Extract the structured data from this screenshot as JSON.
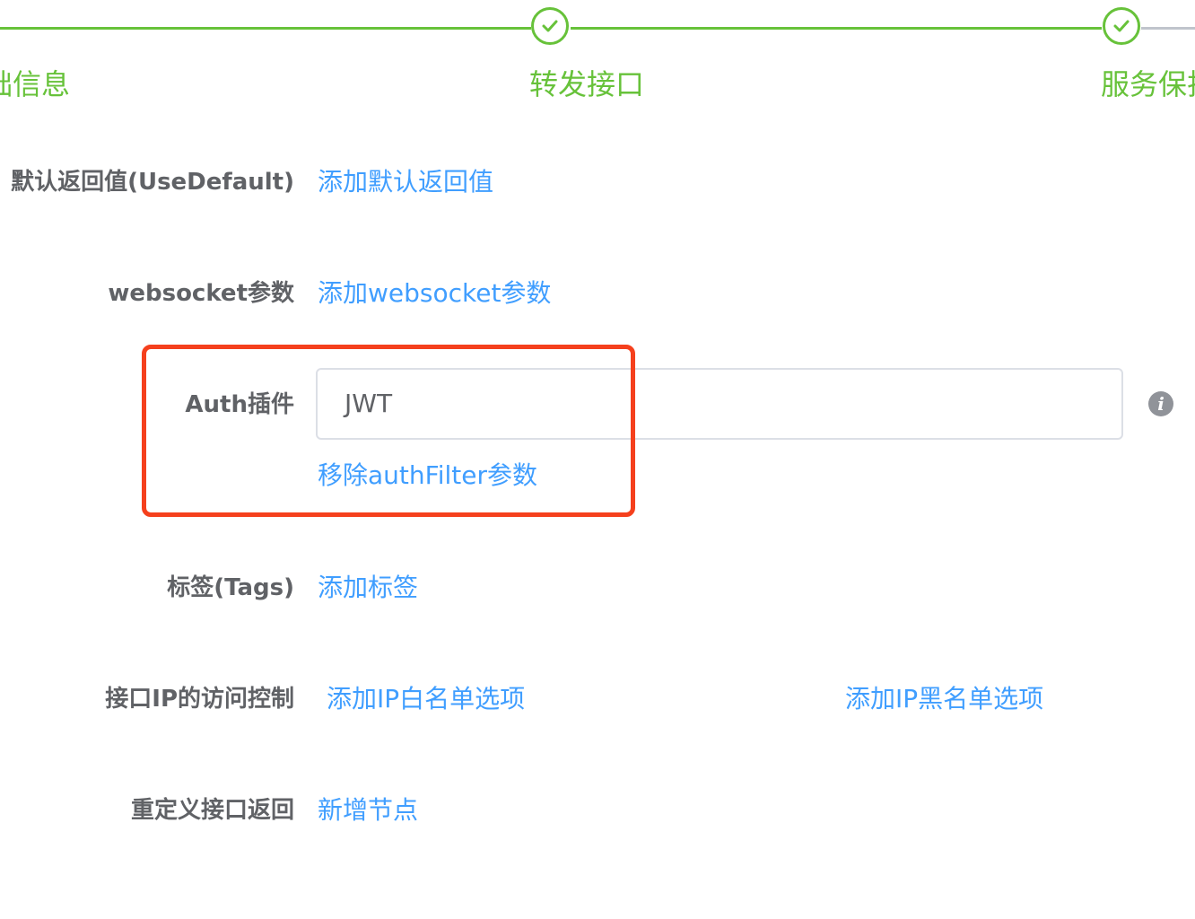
{
  "steps": [
    {
      "title": "础信息",
      "status": "finished"
    },
    {
      "title": "转发接口",
      "status": "finished"
    },
    {
      "title": "服务保护",
      "status": "finished"
    }
  ],
  "colors": {
    "success": "#67c23a",
    "link": "#409eff",
    "label": "#606266",
    "highlight": "#f5401d"
  },
  "form": {
    "use_default": {
      "label": "默认返回值(UseDefault)",
      "action": "添加默认返回值"
    },
    "websocket": {
      "label": "websocket参数",
      "action": "添加websocket参数"
    },
    "auth": {
      "label": "Auth插件",
      "value": "JWT",
      "remove_action": "移除authFilter参数",
      "info_icon": "info-icon"
    },
    "tags": {
      "label": "标签(Tags)",
      "action": "添加标签"
    },
    "ip_control": {
      "label": "接口IP的访问控制",
      "whitelist_action": "添加IP白名单选项",
      "blacklist_action": "添加IP黑名单选项"
    },
    "redefine": {
      "label": "重定义接口返回",
      "action": "新增节点"
    }
  }
}
